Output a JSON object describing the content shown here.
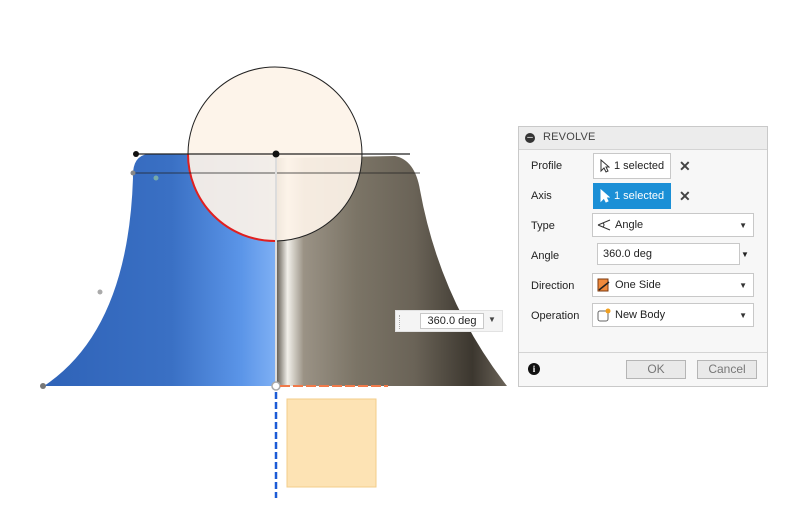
{
  "canvas": {
    "dimension_value": "360.0 deg"
  },
  "panel": {
    "title": "REVOLVE",
    "rows": [
      {
        "label": "Profile",
        "value": "1 selected"
      },
      {
        "label": "Axis",
        "value": "1 selected"
      },
      {
        "label": "Type",
        "value": "Angle"
      },
      {
        "label": "Angle",
        "value": "360.0 deg"
      },
      {
        "label": "Direction",
        "value": "One Side"
      },
      {
        "label": "Operation",
        "value": "New Body"
      }
    ],
    "ok_label": "OK",
    "cancel_label": "Cancel"
  },
  "colors": {
    "accent": "#1b8fd6",
    "body_blue": "#3a70c4",
    "profile_fill": "#fdf3e8",
    "preview_orange": "#fde3b4"
  }
}
